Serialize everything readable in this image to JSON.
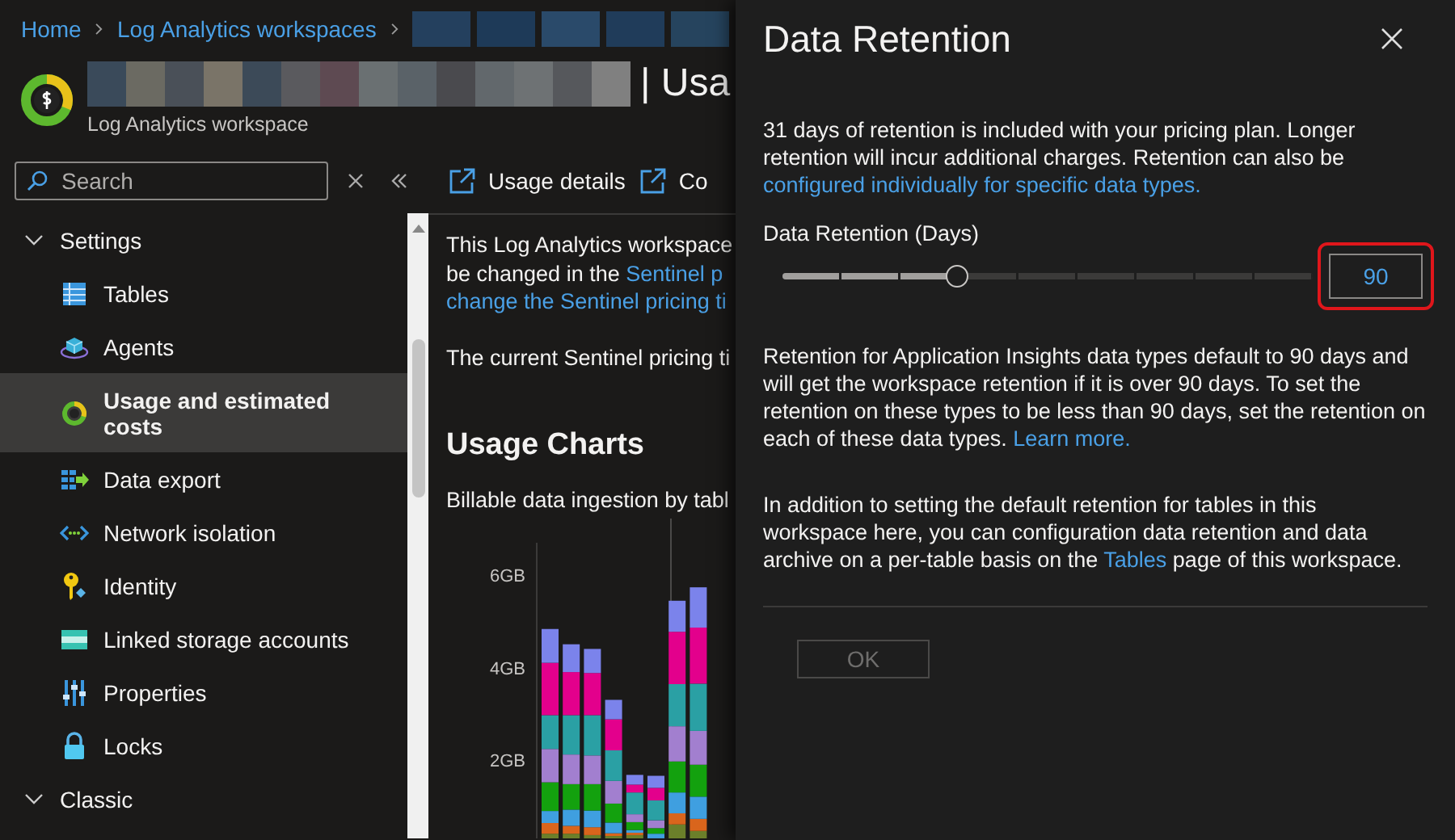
{
  "breadcrumb": [
    {
      "label": "Home"
    },
    {
      "label": "Log Analytics workspaces"
    }
  ],
  "title_suffix": "| Usa",
  "subtitle": "Log Analytics workspace",
  "search": {
    "placeholder": "Search"
  },
  "toolbar": [
    {
      "label": "Usage details"
    },
    {
      "label": "Co"
    }
  ],
  "sidebar": {
    "groups": [
      {
        "label": "Settings",
        "expanded": true,
        "items": [
          {
            "label": "Tables",
            "selected": false
          },
          {
            "label": "Agents",
            "selected": false
          },
          {
            "label": "Usage and estimated costs",
            "selected": true
          },
          {
            "label": "Data export",
            "selected": false
          },
          {
            "label": "Network isolation",
            "selected": false
          },
          {
            "label": "Identity",
            "selected": false
          },
          {
            "label": "Linked storage accounts",
            "selected": false
          },
          {
            "label": "Properties",
            "selected": false
          },
          {
            "label": "Locks",
            "selected": false
          }
        ]
      },
      {
        "label": "Classic",
        "expanded": true
      }
    ]
  },
  "content": {
    "notice": {
      "line_1": "This Log Analytics workspace",
      "line_2": "be changed in the",
      "line_2_link": "Sentinel p",
      "line_3_link": "change the Sentinel pricing ti"
    },
    "pricing_line": "The current Sentinel pricing ti",
    "heading": "Usage Charts",
    "chart_caption": "Billable data ingestion by tabl",
    "chart_ticks": [
      "6GB",
      "4GB",
      "2GB"
    ]
  },
  "dialog": {
    "title": "Data Retention",
    "notes": [
      {
        "before": "31 days of retention is included with your pricing plan. Longer retention will incur additional charges. Retention can also be",
        "link": "configured individually for specific data types."
      }
    ],
    "slider": {
      "label": "Data Retention (Days)",
      "level": 0.33,
      "value": "90",
      "highlighted": true
    },
    "more_notes": [
      {
        "before": "Retention for Application Insights data types default to 90 days and will get the workspace retention if it is over 90 days. To set the retention on these types to be less than 90 days, set the retention on each of these data types.",
        "link": "Learn more."
      },
      {
        "before": "In addition to setting the default retention for tables in this workspace here, you can configuration data retention and data archive on a per-table basis on the",
        "link": "Tables",
        "after": "page of this workspace."
      }
    ],
    "ok": {
      "label": "OK",
      "disabled": true
    }
  }
}
